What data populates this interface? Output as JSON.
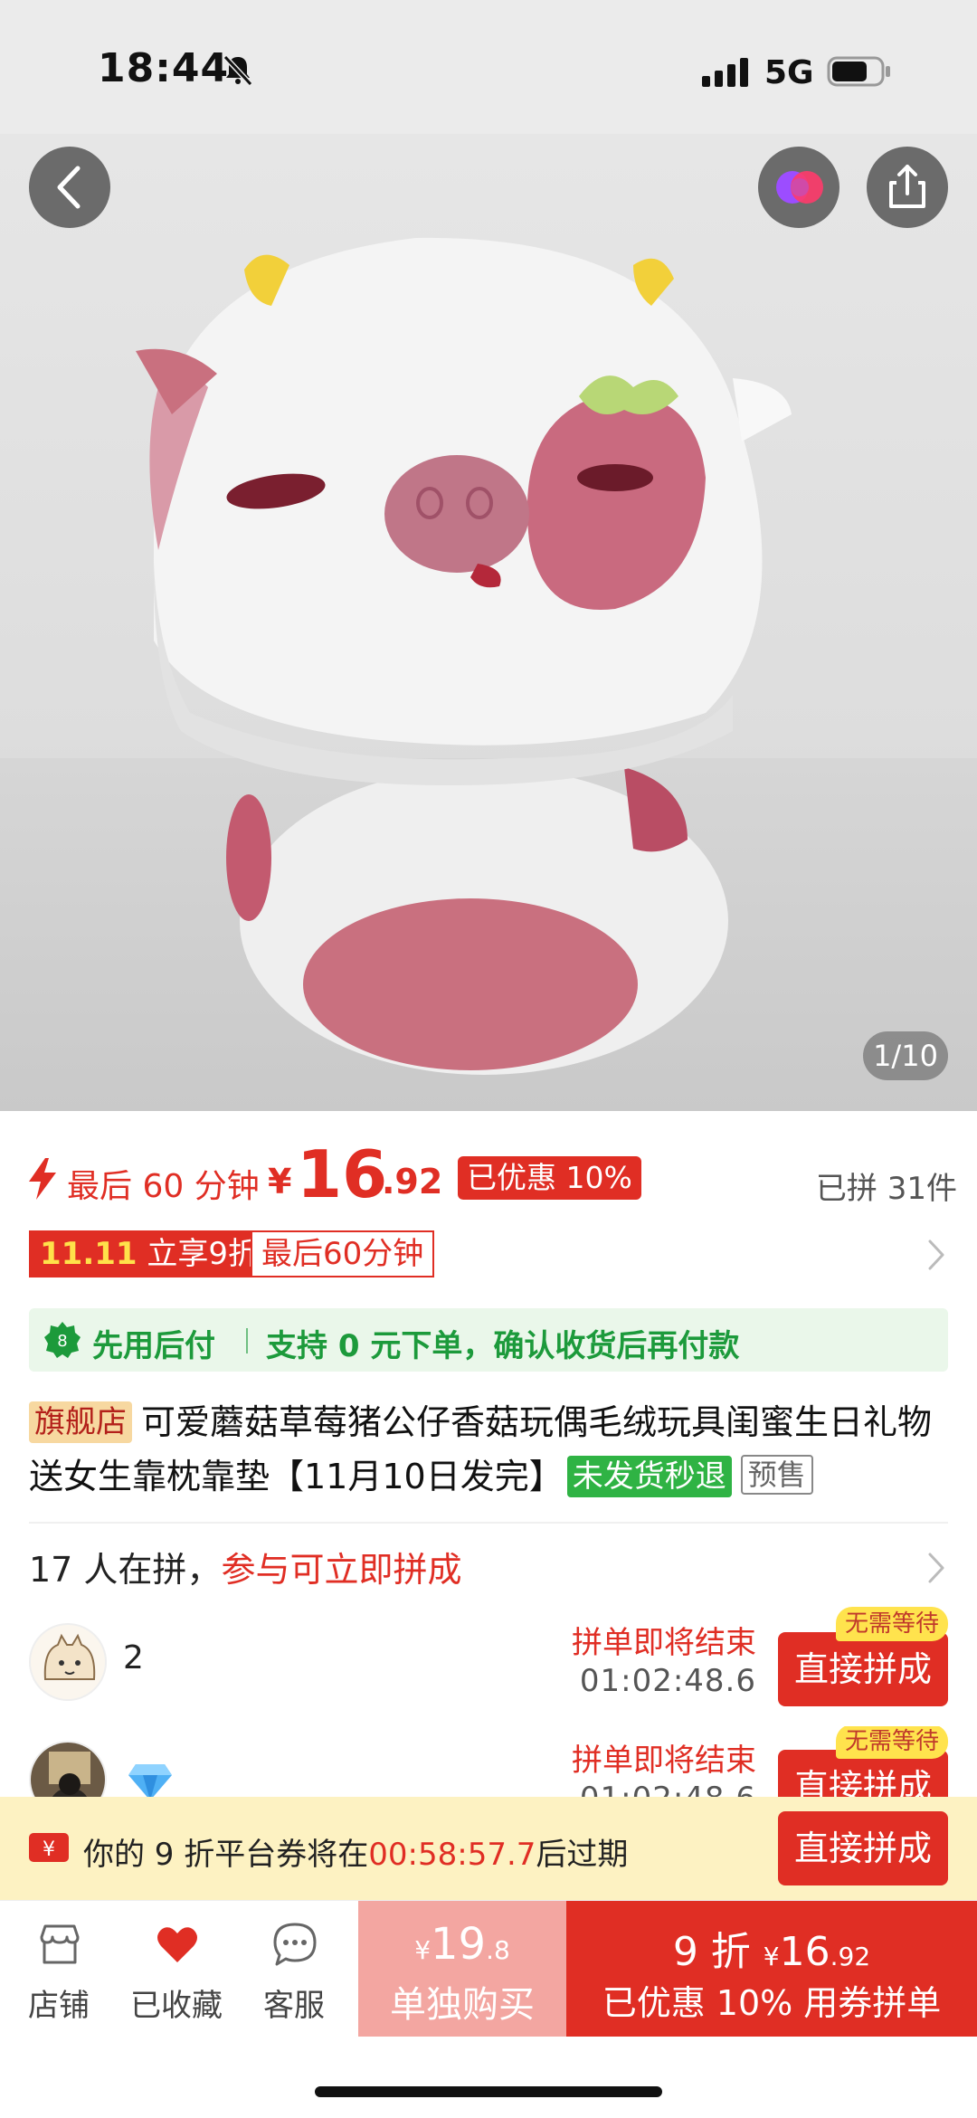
{
  "status_bar": {
    "time": "18:44",
    "network": "5G"
  },
  "gallery": {
    "counter": "1/10"
  },
  "price": {
    "last_minutes": "最后 60 分钟",
    "currency": "¥",
    "integer": "16",
    "decimal": ".92",
    "discount_badge": "已优惠 10%",
    "group_count": "已拼 31件"
  },
  "promo": {
    "tag_highlight": "11.11",
    "tag_text": " 立享9折",
    "outline_text": "最后60分钟"
  },
  "pay_later": {
    "label": "先用后付",
    "text": "支持 0 元下单，确认收货后再付款"
  },
  "title": {
    "store_badge": "旗舰店",
    "text": "可爱蘑菇草莓猪公仔香菇玩偶毛绒玩具闺蜜生日礼物送女生靠枕靠垫【11月10日发完】",
    "refund_badge": "未发货秒退",
    "presale_badge": "预售"
  },
  "group_section": {
    "count_text": "17 人在拼，",
    "join_text": "参与可立即拼成",
    "items": [
      {
        "name": "2",
        "ending_label": "拼单即将结束",
        "countdown": "01:02:48.6",
        "button": "直接拼成",
        "badge": "无需等待"
      },
      {
        "name": "",
        "ending_label": "拼单即将结束",
        "countdown": "01:02:48.6",
        "button": "直接拼成",
        "badge": "无需等待"
      }
    ]
  },
  "coupon": {
    "prefix": "你的 9 折平台券将在",
    "countdown": "00:58:57.7",
    "suffix": "后过期",
    "button": "直接拼成"
  },
  "bottom_nav": {
    "store": "店铺",
    "favorite": "已收藏",
    "service": "客服",
    "buy_alone_currency": "¥",
    "buy_alone_price": "19",
    "buy_alone_decimal": ".8",
    "buy_alone_label": "单独购买",
    "group_prefix": "9 折 ",
    "group_currency": "¥",
    "group_price": "16",
    "group_decimal": ".92",
    "group_label": "已优惠 10% 用券拼单"
  },
  "colors": {
    "accent": "#e02e24",
    "green": "#1c9a3b",
    "coupon_bg": "#fdf2c2",
    "alone_bg": "#f3a6a1"
  }
}
